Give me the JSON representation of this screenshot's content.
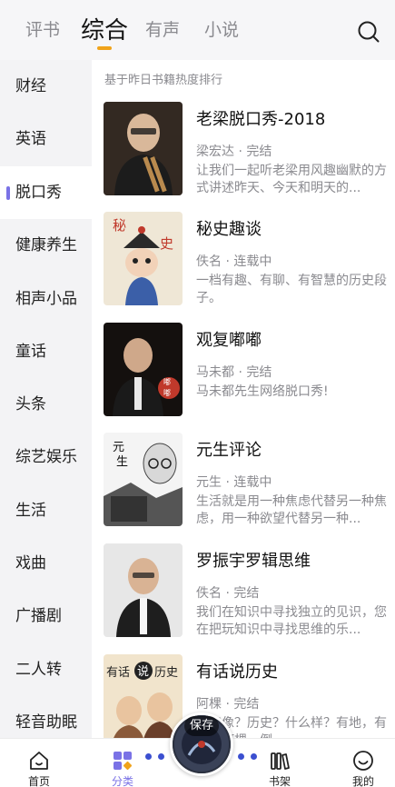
{
  "tabs": [
    {
      "label": "评书",
      "active": false
    },
    {
      "label": "综合",
      "active": true
    },
    {
      "label": "有声",
      "active": false
    },
    {
      "label": "小说",
      "active": false
    }
  ],
  "sidebar": {
    "items": [
      {
        "label": "财经"
      },
      {
        "label": "英语"
      },
      {
        "label": "脱口秀",
        "active": true
      },
      {
        "label": "健康养生"
      },
      {
        "label": "相声小品"
      },
      {
        "label": "童话"
      },
      {
        "label": "头条"
      },
      {
        "label": "综艺娱乐"
      },
      {
        "label": "生活"
      },
      {
        "label": "戏曲"
      },
      {
        "label": "广播剧"
      },
      {
        "label": "二人转"
      },
      {
        "label": "轻音助眠"
      }
    ]
  },
  "list": {
    "hint": "基于昨日书籍热度排行",
    "items": [
      {
        "title": "老梁脱口秀-2018",
        "meta": "梁宏达 · 完结",
        "desc": "让我们一起听老梁用风趣幽默的方式讲述昨天、今天和明天的..."
      },
      {
        "title": "秘史趣谈",
        "meta": "佚名 · 连载中",
        "desc": "一档有趣、有聊、有智慧的历史段子。"
      },
      {
        "title": "观复嘟嘟",
        "meta": "马未都 · 完结",
        "desc": "马未都先生网络脱口秀!"
      },
      {
        "title": "元生评论",
        "meta": "元生 · 连载中",
        "desc": "生活就是用一种焦虑代替另一种焦虑，用一种欲望代替另一种..."
      },
      {
        "title": "罗振宇罗辑思维",
        "meta": "佚名 · 完结",
        "desc": "我们在知识中寻找独立的见识，您在把玩知识中寻找思维的乐..."
      },
      {
        "title": "有话说历史",
        "meta": "阿棵 · 完结",
        "desc": "有点像？历史？什么样？有地，有地，阿棵，倒..."
      }
    ]
  },
  "player": {
    "tag": "保存"
  },
  "bottom_nav": [
    {
      "label": "首页",
      "icon": "home-icon"
    },
    {
      "label": "分类",
      "icon": "category-icon",
      "active": true
    },
    {
      "label": "书架",
      "icon": "bookshelf-icon"
    },
    {
      "label": "我的",
      "icon": "profile-icon"
    }
  ],
  "colors": {
    "accent": "#7a72e6",
    "tab_underline": "#f0a31a",
    "sidebar_bg": "#f3f3f5"
  },
  "icons": {
    "search": "search-icon"
  }
}
